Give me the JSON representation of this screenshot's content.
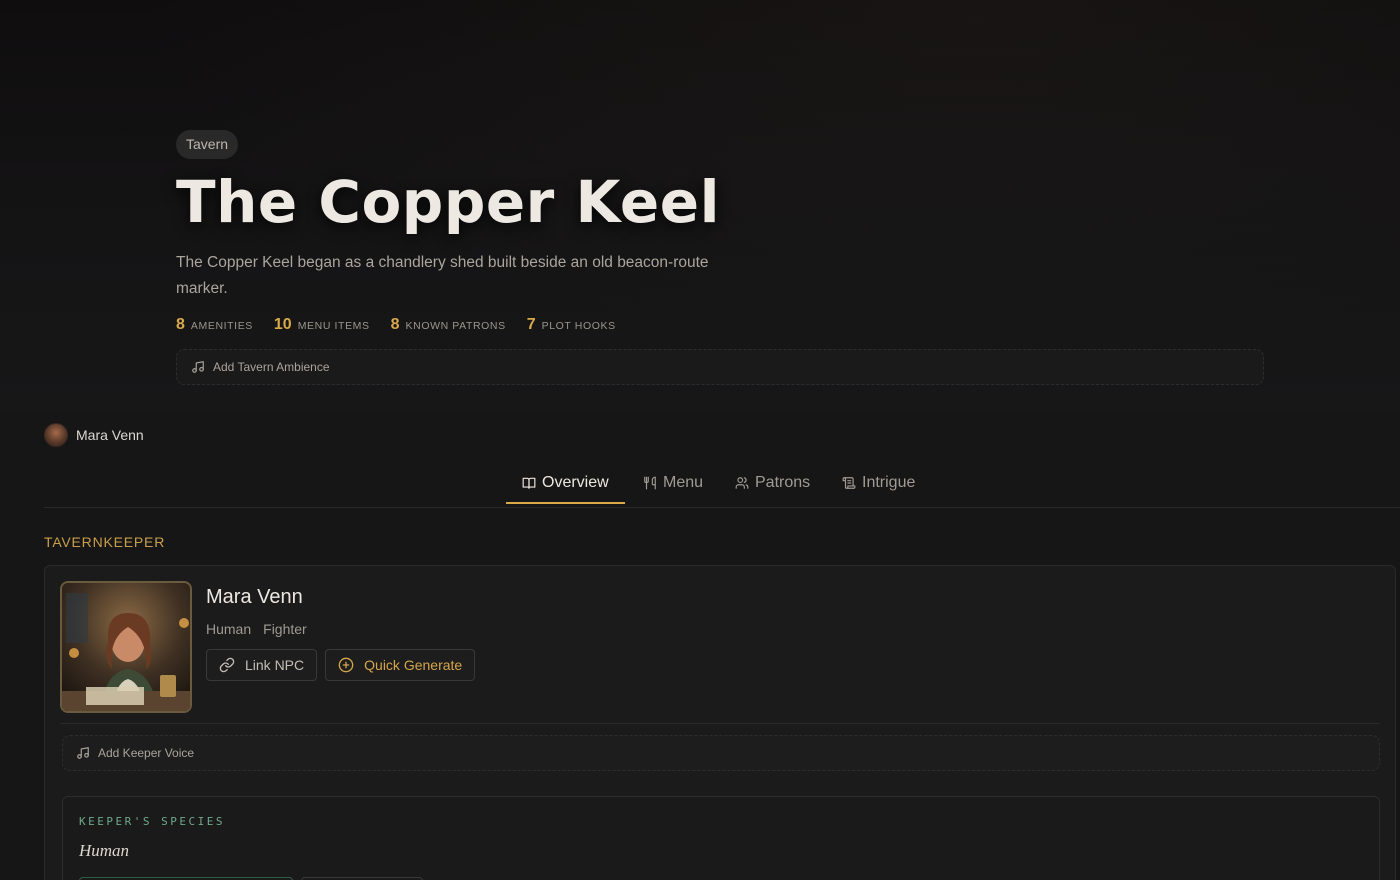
{
  "hero": {
    "badge": "Tavern",
    "title": "The Copper Keel",
    "description": "The Copper Keel began as a chandlery shed built beside an old beacon-route marker.",
    "stats": [
      {
        "value": "8",
        "label": "Amenities"
      },
      {
        "value": "10",
        "label": "Menu Items"
      },
      {
        "value": "8",
        "label": "Known Patrons"
      },
      {
        "value": "7",
        "label": "Plot Hooks"
      }
    ],
    "ambience_label": "Add Tavern Ambience"
  },
  "user": {
    "name": "Mara Venn"
  },
  "tabs": [
    {
      "label": "Overview",
      "icon": "book-icon",
      "active": true
    },
    {
      "label": "Menu",
      "icon": "utensils-icon",
      "active": false
    },
    {
      "label": "Patrons",
      "icon": "users-icon",
      "active": false
    },
    {
      "label": "Intrigue",
      "icon": "scroll-icon",
      "active": false
    }
  ],
  "section": {
    "label": "TAVERNKEEPER"
  },
  "keeper": {
    "name": "Mara Venn",
    "tags": [
      "Human",
      "Fighter"
    ],
    "link_label": "Link NPC",
    "generate_label": "Quick Generate",
    "voice_label": "Add Keeper Voice",
    "species_label": "KEEPER'S SPECIES",
    "species_value": "Human"
  },
  "colors": {
    "accent": "#d9a94a",
    "species_label": "#6fa88a",
    "background": "#161617"
  }
}
